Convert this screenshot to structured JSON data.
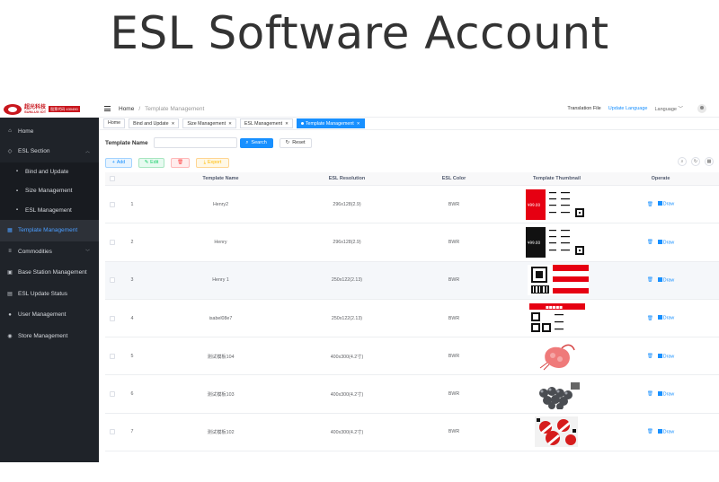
{
  "hero_title": "ESL Software Account",
  "logo": {
    "text": "超光科技",
    "sub": "SUNLUX IOT",
    "badge": "股票代码 430490"
  },
  "sidebar": {
    "items": [
      {
        "label": "Home",
        "icon": "home-icon"
      },
      {
        "label": "ESL Section",
        "icon": "tag-icon",
        "expanded": true
      },
      {
        "label": "Bind and Update",
        "icon": "doc-icon",
        "sub": true
      },
      {
        "label": "Size Management",
        "icon": "doc-icon",
        "sub": true
      },
      {
        "label": "ESL Management",
        "icon": "doc-icon",
        "sub": true
      },
      {
        "label": "Template Management",
        "icon": "template-icon",
        "active": true
      },
      {
        "label": "Commodities",
        "icon": "list-icon",
        "expandable": true
      },
      {
        "label": "Base Station Management",
        "icon": "station-icon"
      },
      {
        "label": "ESL Update Status",
        "icon": "status-icon"
      },
      {
        "label": "User Management",
        "icon": "user-icon"
      },
      {
        "label": "Store Management",
        "icon": "store-icon"
      }
    ]
  },
  "topbar": {
    "breadcrumb_home": "Home",
    "breadcrumb_sep": "/",
    "breadcrumb_current": "Template Management",
    "translation_file": "Translation File",
    "update_language": "Update Language",
    "language": "Language"
  },
  "tabs": [
    {
      "label": "Home"
    },
    {
      "label": "Bind and Update",
      "closable": true
    },
    {
      "label": "Size Management",
      "closable": true
    },
    {
      "label": "ESL Management",
      "closable": true
    },
    {
      "label": "Template Management",
      "closable": true,
      "active": true
    }
  ],
  "search": {
    "label": "Template Name",
    "placeholder": "",
    "search_btn": "Search",
    "reset_btn": "Reset"
  },
  "toolbar": {
    "add": "Add",
    "edit": "Edit",
    "delete": "",
    "export": "Export"
  },
  "table": {
    "headers": [
      "Template Name",
      "ESL Resolution",
      "ESL Color",
      "Template Thumbnail",
      "Operate"
    ],
    "draw_label": "Draw",
    "rows": [
      {
        "idx": "1",
        "name": "Henry2",
        "res": "296x128(2.9)",
        "color": "BWR",
        "thumb": "price-red-black"
      },
      {
        "idx": "2",
        "name": "Henry",
        "res": "296x128(2.9)",
        "color": "BWR",
        "thumb": "price-black"
      },
      {
        "idx": "3",
        "name": "Henry 1",
        "res": "250x122(2.13)",
        "color": "BWR",
        "thumb": "qr-red"
      },
      {
        "idx": "4",
        "name": "isabel08e7",
        "res": "250x122(2.13)",
        "color": "BWR",
        "thumb": "qr-header"
      },
      {
        "idx": "5",
        "name": "测试模板104",
        "res": "400x300(4.2寸)",
        "color": "BWR",
        "thumb": "shrimp"
      },
      {
        "idx": "6",
        "name": "测试模板103",
        "res": "400x300(4.2寸)",
        "color": "BWR",
        "thumb": "grapes"
      },
      {
        "idx": "7",
        "name": "测试模板102",
        "res": "400x300(4.2寸)",
        "color": "BWR",
        "thumb": "apples"
      }
    ]
  },
  "colors": {
    "accent": "#1890ff",
    "sidebar_bg": "#1f2329",
    "active_text": "#4a9dff",
    "brand_red": "#c8161d"
  }
}
